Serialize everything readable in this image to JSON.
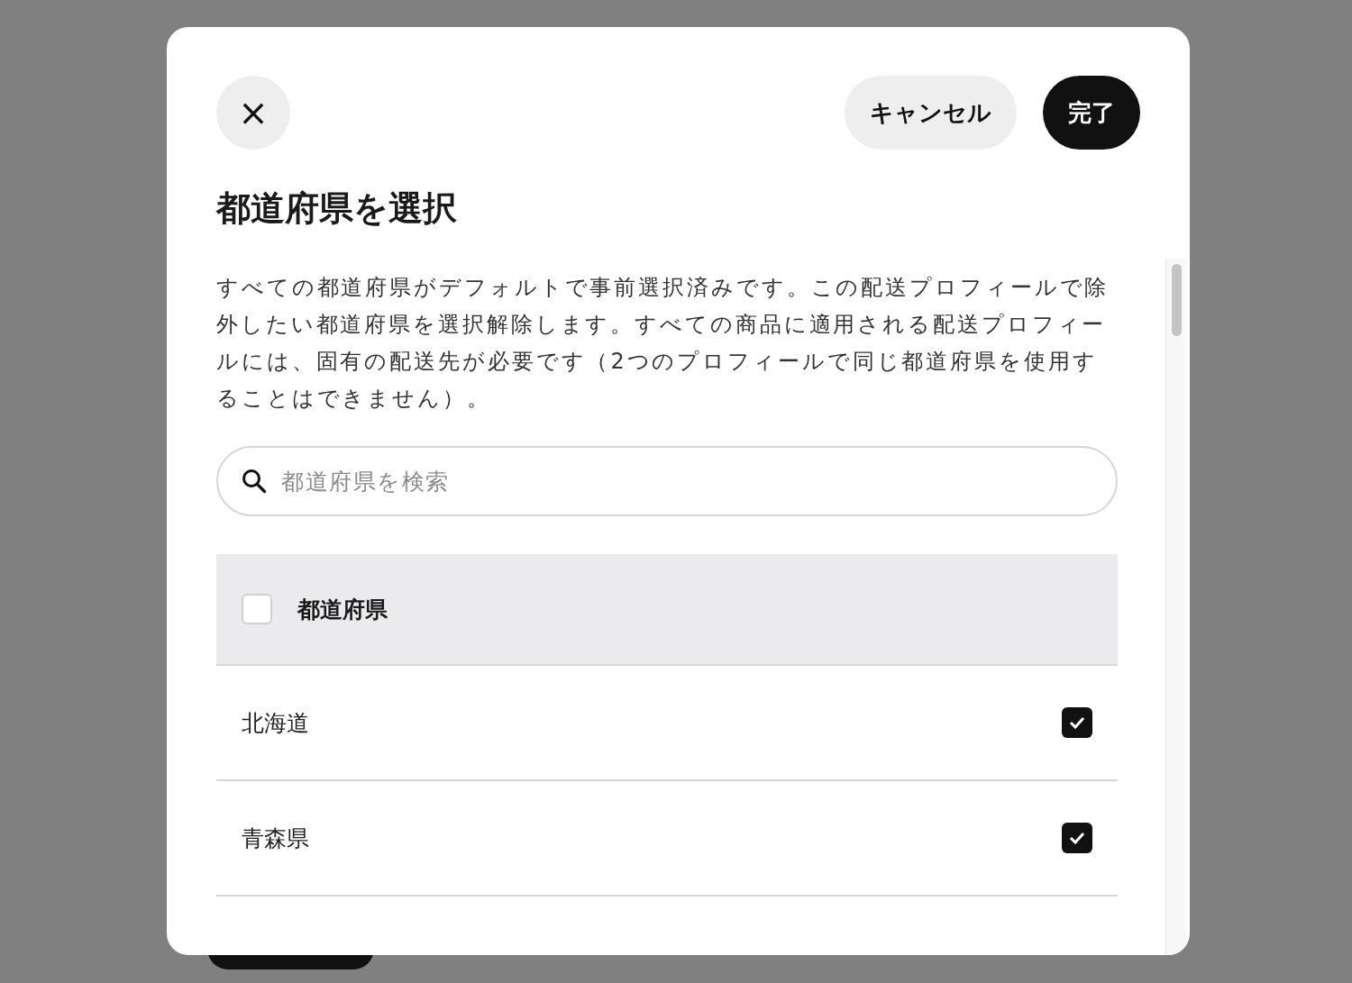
{
  "dialog": {
    "close_label": "×",
    "buttons": [
      {
        "label": "キャンセル",
        "kind": "secondary"
      },
      {
        "label": "完了",
        "kind": "primary"
      }
    ],
    "title": "都道府県を選択",
    "description": "すべての都道府県がデフォルトで事前選択済みです。この配送プロフィールで除外したい都道府県を選択解除します。すべての商品に適用される配送プロフィールには、固有の配送先が必要です（2つのプロフィールで同じ都道府県を使用することはできません）。",
    "search": {
      "placeholder": "都道府県を検索"
    },
    "table": {
      "header": {
        "label": "都道府県",
        "checked": false
      },
      "rows": [
        {
          "name": "北海道",
          "checked": true
        },
        {
          "name": "青森県",
          "checked": true
        }
      ]
    }
  }
}
